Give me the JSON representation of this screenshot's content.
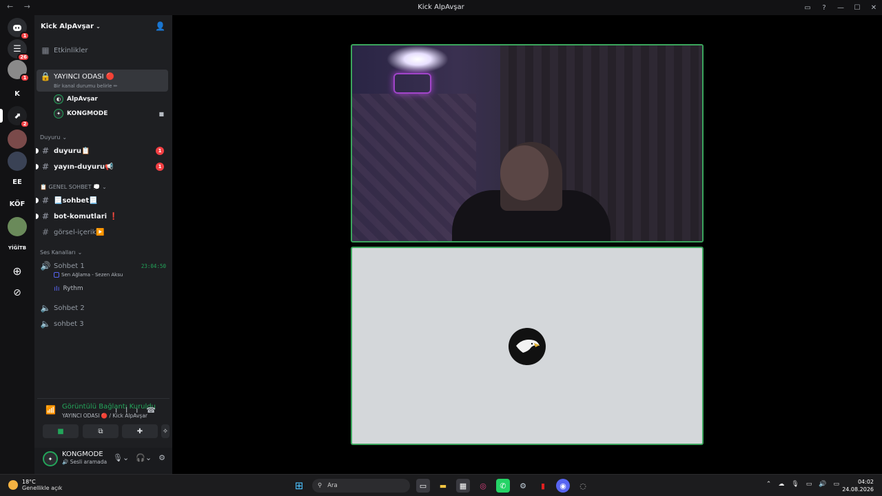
{
  "window": {
    "title": "Kick AlpAvşar"
  },
  "guild_rail": {
    "items": [
      {
        "label": "",
        "icon": "discord-icon",
        "badge": "1"
      },
      {
        "label": "",
        "icon": "server-icon",
        "badge": "26"
      },
      {
        "label": "",
        "icon": "server-avatar",
        "badge": "1"
      },
      {
        "label": "K",
        "icon": "",
        "badge": ""
      },
      {
        "label": "",
        "icon": "server-avatar",
        "badge": "2"
      },
      {
        "label": "",
        "icon": "server-avatar",
        "badge": ""
      },
      {
        "label": "",
        "icon": "server-avatar",
        "badge": ""
      },
      {
        "label": "EE",
        "icon": "",
        "badge": ""
      },
      {
        "label": "KÖF",
        "icon": "",
        "badge": ""
      },
      {
        "label": "",
        "icon": "server-avatar",
        "badge": ""
      },
      {
        "label": "YİĞİTB",
        "icon": "",
        "badge": ""
      }
    ]
  },
  "server": {
    "name": "Kick AlpAvşar"
  },
  "events": {
    "label": "Etkinlikler"
  },
  "active_channel": {
    "name": "YAYINCI ODASI 🔴",
    "status_placeholder": "Bir kanal durumu belirle ✏",
    "users": [
      "AlpAvşar",
      "KONGMODE"
    ]
  },
  "categories": {
    "duyuru": "Duyuru",
    "genel": "📋 GENEL SOHBET 💭",
    "voice": "Ses Kanalları"
  },
  "channels": {
    "duyuru": {
      "name": "duyuru📋",
      "mentions": "1"
    },
    "yayin_duyuru": {
      "name": "yayın-duyuru📢",
      "mentions": "1"
    },
    "sohbet": {
      "name": "📃sohbet📃"
    },
    "bot": {
      "name": "bot-komutlari ❗"
    },
    "gorsel": {
      "name": "görsel-içerik▶️"
    }
  },
  "voice_channels": {
    "sohbet1": {
      "name": "Sohbet 1",
      "timer": "23:04:50",
      "activity": "Sen Ağlama - Sezen Aksu",
      "user": "Rythm"
    },
    "sohbet2": {
      "name": "Sohbet 2"
    },
    "sohbet3": {
      "name": "sohbet 3"
    }
  },
  "voice_panel": {
    "title": "Görüntülü Bağlantı Kuruldu",
    "subtitle": "YAYINCI ODASI 🔴 / Kick AlpAvşar"
  },
  "user_panel": {
    "name": "KONGMODE",
    "status": "🔊 Sesli aramada"
  },
  "taskbar": {
    "weather_temp": "18°C",
    "weather_desc": "Genellikle açık",
    "search_label": "Ara",
    "time": "04:02",
    "date": "24.08.2026"
  },
  "colors": {
    "accent_green": "#23a55a",
    "mention_red": "#f23f43",
    "sidebar": "#1e1f22",
    "rail": "#121214"
  }
}
